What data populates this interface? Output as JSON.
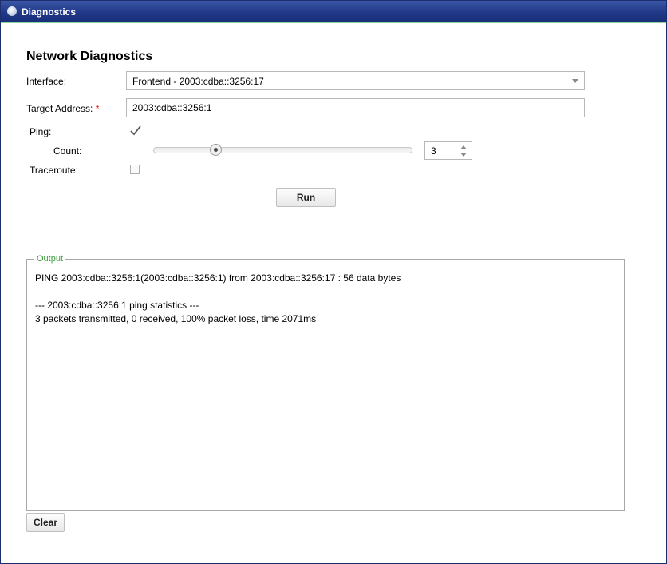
{
  "window": {
    "title": "Diagnostics"
  },
  "form": {
    "heading": "Network Diagnostics",
    "interface": {
      "label": "Interface:",
      "value": "Frontend - 2003:cdba::3256:17"
    },
    "target": {
      "label": "Target Address:",
      "required_mark": "*",
      "value": "2003:cdba::3256:1"
    },
    "ping": {
      "label": "Ping:",
      "checked": true
    },
    "count": {
      "label": "Count:",
      "value": "3",
      "slider_fraction": 0.23
    },
    "traceroute": {
      "label": "Traceroute:",
      "checked": false
    },
    "run_label": "Run"
  },
  "output": {
    "legend": "Output",
    "lines": [
      "PING 2003:cdba::3256:1(2003:cdba::3256:1) from 2003:cdba::3256:17 : 56 data bytes",
      "",
      "--- 2003:cdba::3256:1 ping statistics ---",
      "3 packets transmitted, 0 received, 100% packet loss, time 2071ms"
    ],
    "clear_label": "Clear"
  },
  "colors": {
    "titlebar": "#1f3785",
    "accent": "#3a9a3a",
    "required": "#dd0000"
  }
}
